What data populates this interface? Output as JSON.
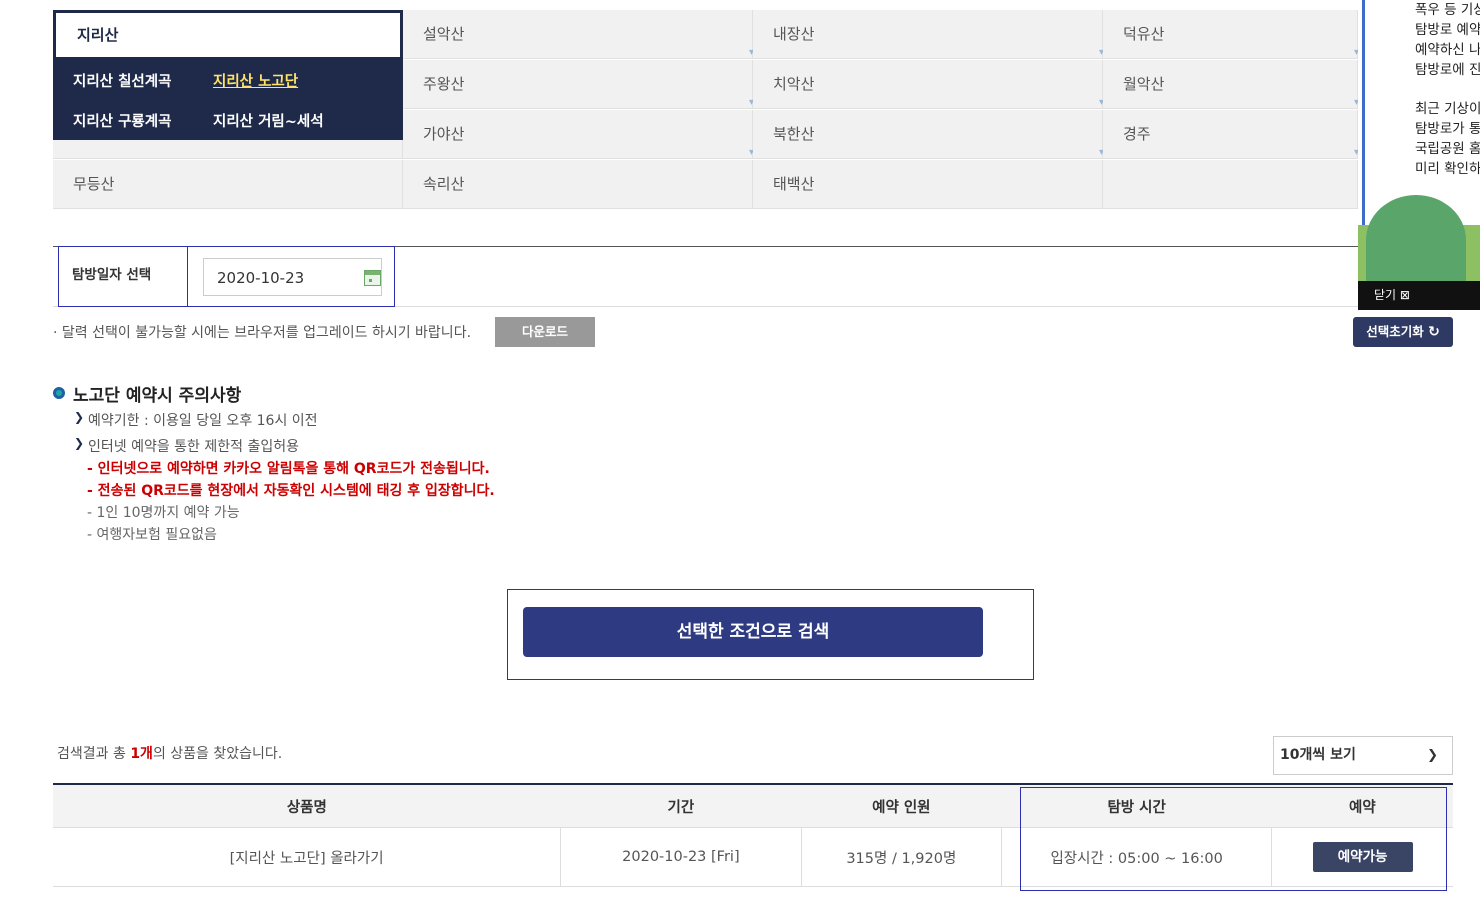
{
  "mountains": {
    "selected": "지리산",
    "submenu": [
      "지리산 칠선계곡",
      "지리산 노고단",
      "지리산 구룡계곡",
      "지리산 거림~세석"
    ],
    "active_submenu": "지리산 노고단",
    "grid": [
      [
        "",
        "설악산",
        "내장산",
        "덕유산"
      ],
      [
        "",
        "주왕산",
        "치악산",
        "월악산"
      ],
      [
        "",
        "가야산",
        "북한산",
        "경주"
      ],
      [
        "무등산",
        "속리산",
        "태백산",
        ""
      ]
    ]
  },
  "date": {
    "label": "탐방일자 선택",
    "value": "2020-10-23"
  },
  "notice": {
    "text": "· 달력 선택이 불가능할 시에는 브라우저를 업그레이드 하시기 바랍니다.",
    "download_label": "다운로드",
    "reset_label": "선택초기화"
  },
  "caution": {
    "title": "노고단 예약시 주의사항",
    "items": [
      "예약기한 : 이용일 당일 오후 16시 이전",
      "인터넷 예약을 통한 제한적 출입허용"
    ],
    "sub_items_red": [
      "- 인터넷으로 예약하면 카카오 알림톡을 통해 QR코드가 전송됩니다.",
      "- 전송된 QR코드를 현장에서 자동확인 시스템에 태깅 후 입장합니다."
    ],
    "sub_items_grey": [
      "- 1인 10명까지 예약 가능",
      "- 여행자보험 필요없음"
    ]
  },
  "search": {
    "button_label": "선택한 조건으로 검색"
  },
  "results": {
    "count_prefix": "검색결과 총 ",
    "count_value": "1개",
    "count_suffix": "의 상품을 찾았습니다.",
    "per_page": "10개씩 보기",
    "headers": [
      "상품명",
      "기간",
      "예약 인원",
      "탐방 시간",
      "예약"
    ],
    "rows": [
      {
        "name": "[지리산 노고단] 올라가기",
        "period": "2020-10-23 [Fri]",
        "people": "315명 / 1,920명",
        "time": "입장시간 : 05:00 ~ 16:00",
        "action": "예약가능"
      }
    ]
  },
  "popup": {
    "lines": [
      "폭우 등 기상",
      "탐방로 예약",
      "예약하신 나",
      "탐방로에 진",
      "",
      "최근 기상이",
      "탐방로가 통",
      "국립공원 홈",
      "미리 확인하"
    ],
    "close_label": "닫기 ⊠"
  }
}
